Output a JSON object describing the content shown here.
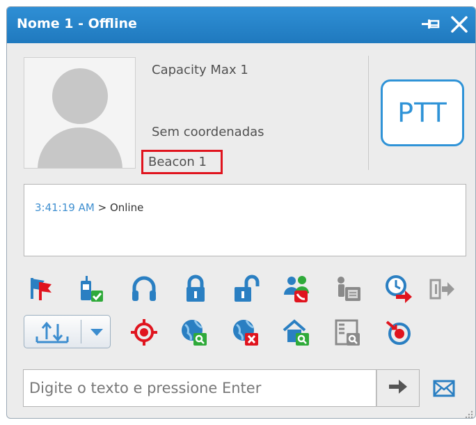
{
  "window": {
    "title": "Nome 1 - Offline"
  },
  "profile": {
    "radio_name": "Capacity Max 1",
    "coordinates": "Sem coordenadas",
    "beacon": "Beacon 1",
    "ptt_label": "PTT"
  },
  "log": {
    "time": "3:41:19 AM",
    "separator": ">",
    "status": "Online"
  },
  "toolbar_row1": [
    "flags-icon",
    "radio-check-icon",
    "headset-icon",
    "lock-icon",
    "unlock-icon",
    "users-call-icon",
    "phone-fax-icon",
    "clock-arrow-icon",
    "exit-icon"
  ],
  "toolbar_row2": [
    "split-arrows-button",
    "target-icon",
    "globe-search-icon",
    "globe-remove-icon",
    "home-search-icon",
    "building-search-icon",
    "target-reset-icon"
  ],
  "message": {
    "placeholder": "Digite o texto e pressione Enter"
  },
  "colors": {
    "titlebar": "#1f79be",
    "accent": "#2f93d7",
    "highlight": "#e0141e"
  }
}
